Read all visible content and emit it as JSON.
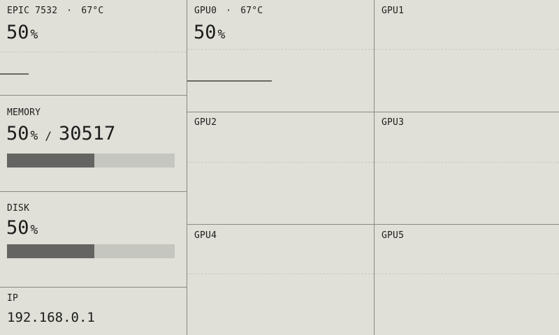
{
  "cpu": {
    "label": "EPIC 7532",
    "separator": "·",
    "temp": "67°C",
    "usage_value": "50",
    "usage_unit": "%"
  },
  "memory": {
    "label": "MEMORY",
    "usage_value": "50",
    "usage_unit": "%",
    "slash": "/",
    "total": "30517",
    "fill_fraction": 0.52
  },
  "disk": {
    "label": "DISK",
    "usage_value": "50",
    "usage_unit": "%",
    "fill_fraction": 0.52
  },
  "ip": {
    "label": "IP",
    "value": "192.168.0.1"
  },
  "gpus": [
    {
      "label": "GPU0",
      "separator": "·",
      "temp": "67°C",
      "usage_value": "50",
      "usage_unit": "%"
    },
    {
      "label": "GPU1"
    },
    {
      "label": "GPU2"
    },
    {
      "label": "GPU3"
    },
    {
      "label": "GPU4"
    },
    {
      "label": "GPU5"
    }
  ],
  "colors": {
    "background": "#e0e0d8",
    "bar_fill": "#646462",
    "bar_track": "#c6c6c0",
    "divider": "#8a8a86"
  }
}
